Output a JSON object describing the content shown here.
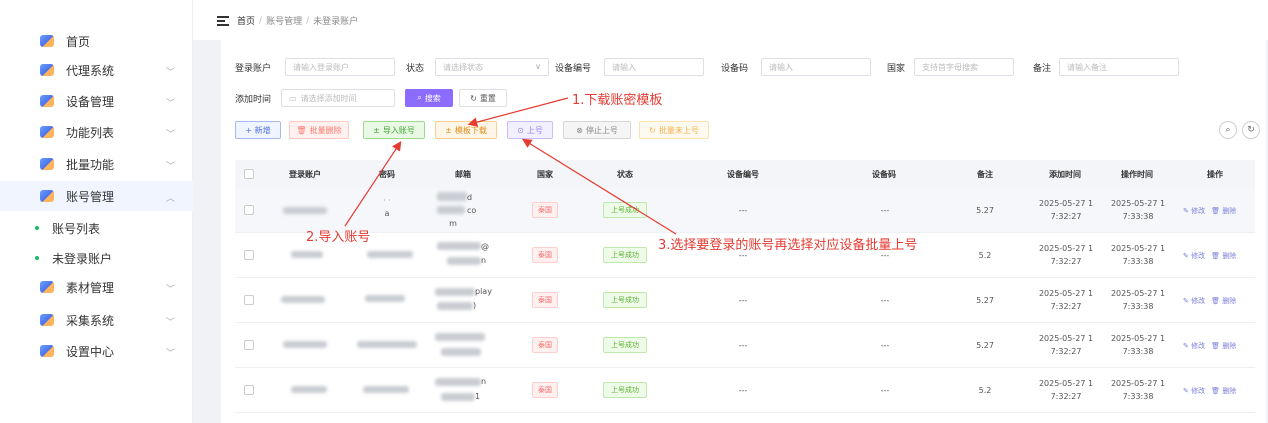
{
  "sidebar": {
    "items": [
      {
        "label": "首页",
        "icon": "home-icon"
      },
      {
        "label": "代理系统",
        "icon": "proxy-icon"
      },
      {
        "label": "设备管理",
        "icon": "device-icon"
      },
      {
        "label": "功能列表",
        "icon": "function-icon"
      },
      {
        "label": "批量功能",
        "icon": "batch-icon"
      },
      {
        "label": "账号管理",
        "icon": "account-icon"
      },
      {
        "label": "素材管理",
        "icon": "material-icon"
      },
      {
        "label": "采集系统",
        "icon": "collect-icon"
      },
      {
        "label": "设置中心",
        "icon": "settings-icon"
      }
    ],
    "sub_items": [
      {
        "label": "账号列表"
      },
      {
        "label": "未登录账户"
      }
    ]
  },
  "breadcrumb": {
    "home": "首页",
    "parent": "账号管理",
    "current": "未登录账户",
    "separator": "/"
  },
  "filters": {
    "account": {
      "label": "登录账户",
      "placeholder": "请输入登录账户"
    },
    "status": {
      "label": "状态",
      "placeholder": "请选择状态"
    },
    "device_no": {
      "label": "设备编号",
      "placeholder": "请输入"
    },
    "device_code": {
      "label": "设备码",
      "placeholder": "请输入"
    },
    "country": {
      "label": "国家",
      "placeholder": "支持首字母搜索"
    },
    "remark": {
      "label": "备注",
      "placeholder": "请输入备注"
    },
    "add_time": {
      "label": "添加时间",
      "placeholder": "请选择添加时间"
    },
    "search_label": "搜索",
    "reset_label": "重置"
  },
  "toolbar": {
    "add": "+ 新增",
    "batch_delete": "批量删除",
    "import": "导入账号",
    "template": "模板下载",
    "login": "上号",
    "stop": "停止上号",
    "batch_login": "批量未上号"
  },
  "table": {
    "headers": [
      "登录账户",
      "密码",
      "邮箱",
      "国家",
      "状态",
      "设备编号",
      "设备码",
      "备注",
      "添加时间",
      "操作时间",
      "操作"
    ],
    "rows": [
      {
        "email_end": "d",
        "email_mid": "co",
        "email_tail": "m",
        "password_tail": "a",
        "country": "泰国",
        "status": "上号成功",
        "device_no": "---",
        "device_code": "---",
        "remark": "5.27",
        "added": "2025-05-27 1\n7:32:27",
        "operated": "2025-05-27 1\n7:33:38"
      },
      {
        "email_end": "@",
        "email_mid": "",
        "email_tail": "n",
        "password_tail": "",
        "country": "泰国",
        "status": "上号成功",
        "device_no": "---",
        "device_code": "---",
        "remark": "5.2",
        "added": "2025-05-27 1\n7:32:27",
        "operated": "2025-05-27 1\n7:33:38"
      },
      {
        "email_end": "play",
        "email_mid": "",
        "email_tail": ")",
        "password_tail": "",
        "country": "泰国",
        "status": "上号成功",
        "device_no": "---",
        "device_code": "---",
        "remark": "5.27",
        "added": "2025-05-27 1\n7:32:27",
        "operated": "2025-05-27 1\n7:33:38"
      },
      {
        "email_end": "",
        "email_mid": "",
        "email_tail": "",
        "password_tail": "",
        "country": "泰国",
        "status": "上号成功",
        "device_no": "---",
        "device_code": "---",
        "remark": "5.27",
        "added": "2025-05-27 1\n7:32:27",
        "operated": "2025-05-27 1\n7:33:38"
      },
      {
        "email_end": "n",
        "email_mid": "",
        "email_tail": "1",
        "password_tail": "",
        "country": "泰国",
        "status": "上号成功",
        "device_no": "---",
        "device_code": "---",
        "remark": "5.2",
        "added": "2025-05-27 1\n7:32:27",
        "operated": "2025-05-27 1\n7:33:38"
      }
    ],
    "edit_label": "修改",
    "delete_label": "删除"
  },
  "annotations": {
    "step1": "1.下载账密模板",
    "step2": "2.导入账号",
    "step3": "3.选择要登录的账号再选择对应设备批量上号",
    "color": "#e43b32"
  }
}
